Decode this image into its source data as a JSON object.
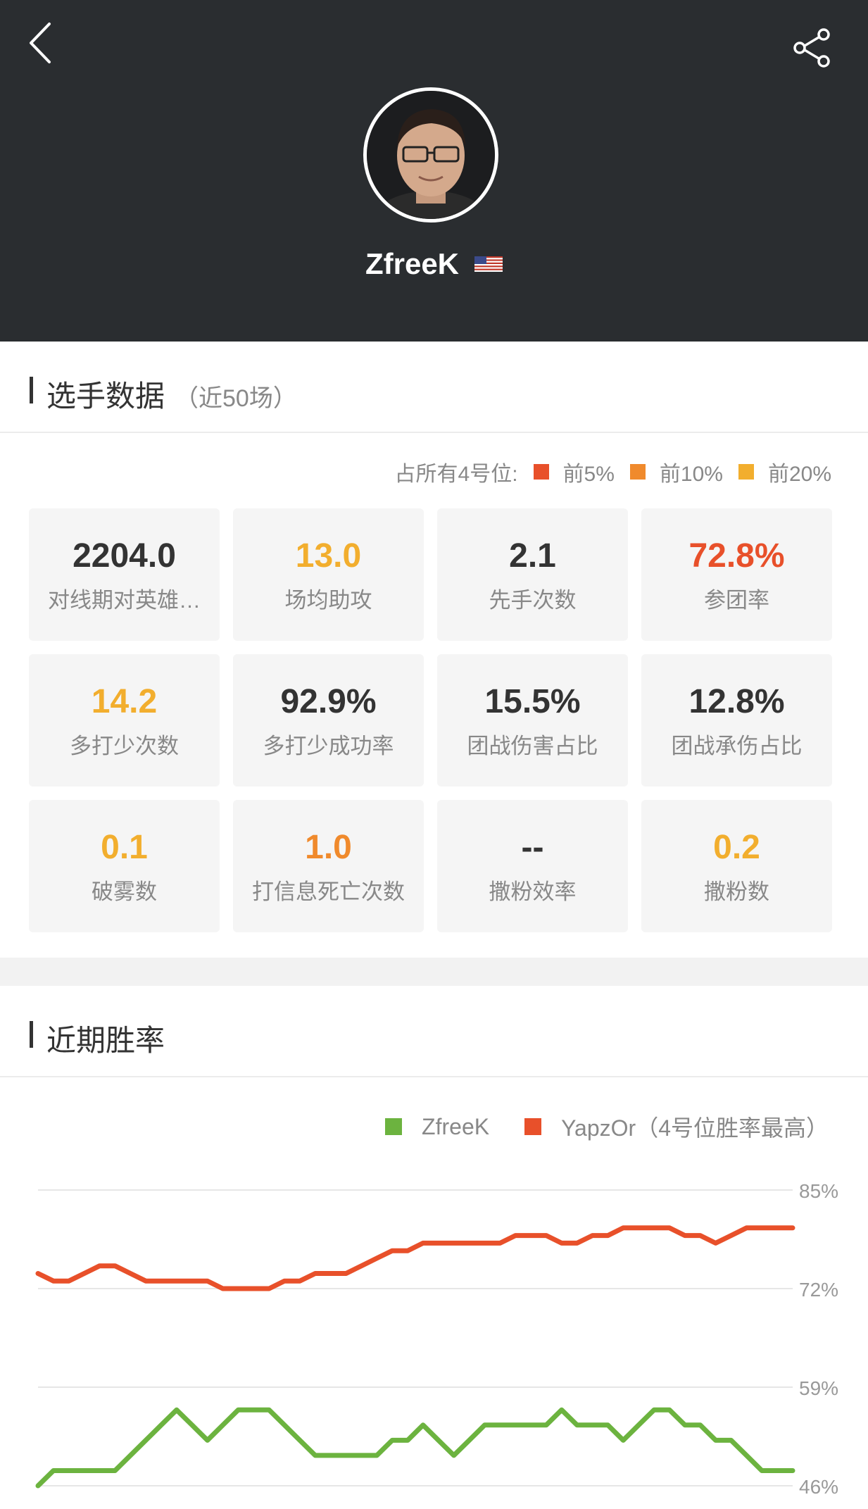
{
  "header": {
    "player_name": "ZfreeK",
    "flag": "us-flag",
    "icons": {
      "back": "chevron-left-icon",
      "share": "share-icon"
    }
  },
  "stats_section": {
    "title": "选手数据",
    "subtitle": "（近50场）",
    "legend": {
      "label": "占所有4号位:",
      "items": [
        {
          "label": "前5%",
          "color": "#e8502a"
        },
        {
          "label": "前10%",
          "color": "#f08a2c"
        },
        {
          "label": "前20%",
          "color": "#f2ae2e"
        }
      ]
    },
    "cells": [
      {
        "value": "2204.0",
        "label": "对线期对英雄…",
        "color": "#333333"
      },
      {
        "value": "13.0",
        "label": "场均助攻",
        "color": "#f2ae2e"
      },
      {
        "value": "2.1",
        "label": "先手次数",
        "color": "#333333"
      },
      {
        "value": "72.8%",
        "label": "参团率",
        "color": "#e8502a"
      },
      {
        "value": "14.2",
        "label": "多打少次数",
        "color": "#f2ae2e"
      },
      {
        "value": "92.9%",
        "label": "多打少成功率",
        "color": "#333333"
      },
      {
        "value": "15.5%",
        "label": "团战伤害占比",
        "color": "#333333"
      },
      {
        "value": "12.8%",
        "label": "团战承伤占比",
        "color": "#333333"
      },
      {
        "value": "0.1",
        "label": "破雾数",
        "color": "#f2ae2e"
      },
      {
        "value": "1.0",
        "label": "打信息死亡次数",
        "color": "#f08a2c"
      },
      {
        "value": "--",
        "label": "撒粉效率",
        "color": "#333333"
      },
      {
        "value": "0.2",
        "label": "撒粉数",
        "color": "#f2ae2e"
      }
    ]
  },
  "winrate_section": {
    "title": "近期胜率"
  },
  "chart_data": {
    "type": "line",
    "yticks": [
      "85%",
      "72%",
      "59%",
      "46%"
    ],
    "ylim": [
      46,
      85
    ],
    "grid": true,
    "legend_position": "top-right",
    "x": [
      1,
      2,
      3,
      4,
      5,
      6,
      7,
      8,
      9,
      10,
      11,
      12,
      13,
      14,
      15,
      16,
      17,
      18,
      19,
      20,
      21,
      22,
      23,
      24,
      25,
      26,
      27,
      28,
      29,
      30,
      31,
      32,
      33,
      34,
      35,
      36,
      37,
      38,
      39,
      40,
      41,
      42,
      43,
      44,
      45,
      46,
      47,
      48,
      49,
      50
    ],
    "series": [
      {
        "name": "ZfreeK",
        "color": "#6cb33f",
        "values": [
          46,
          48,
          48,
          48,
          48,
          48,
          50,
          52,
          54,
          56,
          54,
          52,
          54,
          56,
          56,
          56,
          54,
          52,
          50,
          50,
          50,
          50,
          50,
          52,
          52,
          54,
          52,
          50,
          52,
          54,
          54,
          54,
          54,
          54,
          56,
          54,
          54,
          54,
          52,
          54,
          56,
          56,
          54,
          54,
          52,
          52,
          50,
          48,
          48,
          48
        ]
      },
      {
        "name": "YapzOr（4号位胜率最高）",
        "color": "#e8502a",
        "values": [
          74,
          73,
          73,
          74,
          75,
          75,
          74,
          73,
          73,
          73,
          73,
          73,
          72,
          72,
          72,
          72,
          73,
          73,
          74,
          74,
          74,
          75,
          76,
          77,
          77,
          78,
          78,
          78,
          78,
          78,
          78,
          79,
          79,
          79,
          78,
          78,
          79,
          79,
          80,
          80,
          80,
          80,
          79,
          79,
          78,
          79,
          80,
          80,
          80,
          80
        ]
      }
    ]
  }
}
